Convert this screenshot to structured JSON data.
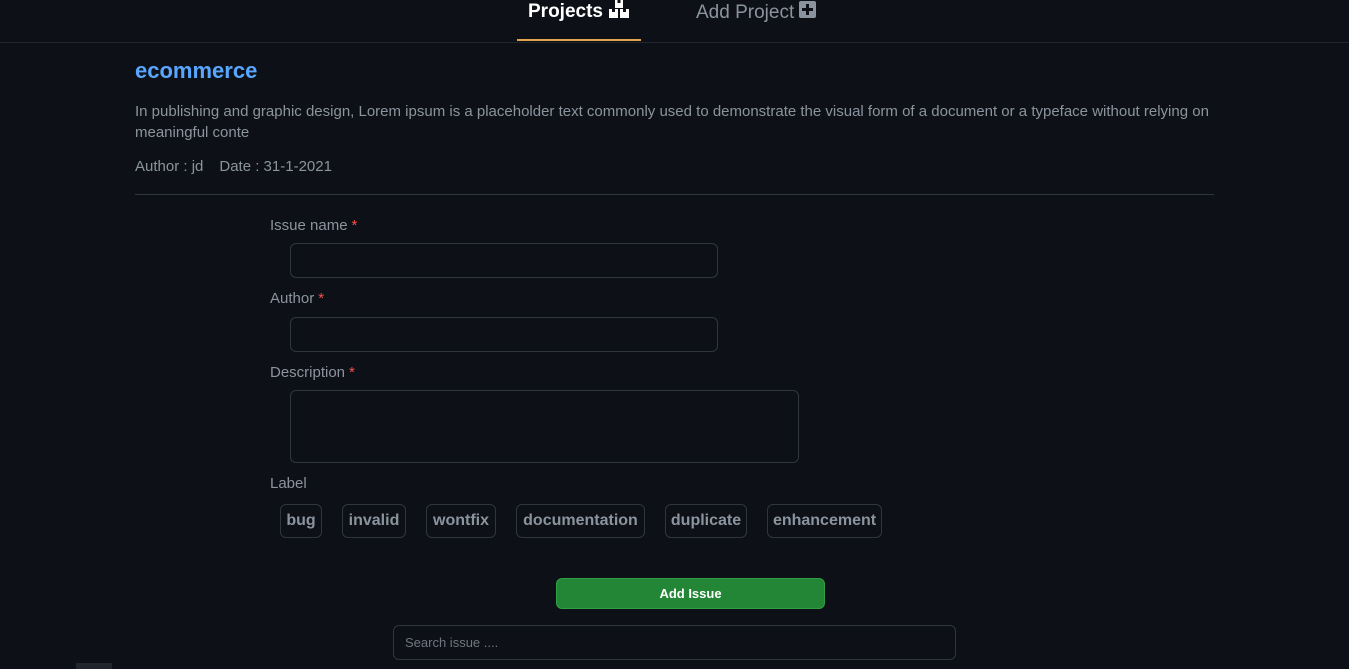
{
  "nav": {
    "tabs": [
      {
        "label": "Projects",
        "icon": "projects-icon",
        "active": true
      },
      {
        "label": "Add Project",
        "icon": "plus-square-icon",
        "active": false
      }
    ]
  },
  "project": {
    "title": "ecommerce",
    "description": "In publishing and graphic design, Lorem ipsum is a placeholder text commonly used to demonstrate the visual form of a document or a typeface without relying on meaningful conte",
    "author": "Author : jd",
    "date": "Date : 31-1-2021"
  },
  "form": {
    "issue_name_label": "Issue name",
    "author_label": "Author",
    "description_label": "Description",
    "label_label": "Label",
    "required_marker": "*",
    "issue_name_value": "",
    "author_value": "",
    "description_value": "",
    "labels": [
      "bug",
      "invalid",
      "wontfix",
      "documentation",
      "duplicate",
      "enhancement"
    ],
    "submit_label": "Add Issue"
  },
  "search": {
    "placeholder": "Search issue ...."
  },
  "colors": {
    "background": "#0d1117",
    "accent_link": "#58a6ff",
    "active_tab_underline": "#e3a34f",
    "submit_green": "#238636",
    "required_red": "#f85149"
  }
}
